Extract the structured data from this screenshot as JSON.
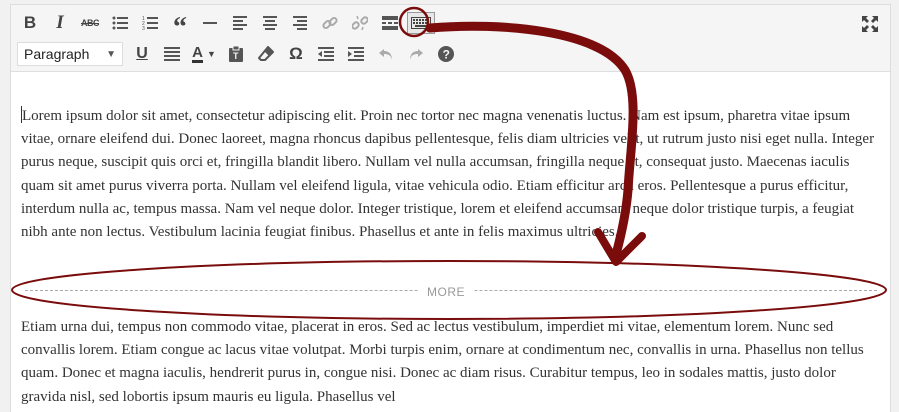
{
  "toolbar": {
    "row1": [
      {
        "name": "bold-button",
        "glyph": "B"
      },
      {
        "name": "italic-button",
        "glyph": "I"
      },
      {
        "name": "strikethrough-button",
        "glyph": "ABC"
      },
      {
        "name": "bulleted-list-button",
        "glyph": "bullets"
      },
      {
        "name": "numbered-list-button",
        "glyph": "numbers"
      },
      {
        "name": "blockquote-button",
        "glyph": "quote"
      },
      {
        "name": "horizontal-line-button",
        "glyph": "hr"
      },
      {
        "name": "align-left-button",
        "glyph": "align-left"
      },
      {
        "name": "align-center-button",
        "glyph": "align-center"
      },
      {
        "name": "align-right-button",
        "glyph": "align-right"
      },
      {
        "name": "insert-link-button",
        "glyph": "link"
      },
      {
        "name": "remove-link-button",
        "glyph": "unlink"
      },
      {
        "name": "insert-more-tag-button",
        "glyph": "more"
      },
      {
        "name": "toolbar-toggle-button",
        "glyph": "keyboard"
      }
    ],
    "format_select": {
      "value": "Paragraph"
    },
    "row2": [
      {
        "name": "underline-button",
        "glyph": "U"
      },
      {
        "name": "justify-button",
        "glyph": "justify"
      },
      {
        "name": "text-color-button",
        "glyph": "A"
      },
      {
        "name": "paste-as-text-button",
        "glyph": "paste"
      },
      {
        "name": "clear-formatting-button",
        "glyph": "eraser"
      },
      {
        "name": "special-character-button",
        "glyph": "Ω"
      },
      {
        "name": "decrease-indent-button",
        "glyph": "outdent"
      },
      {
        "name": "increase-indent-button",
        "glyph": "indent"
      },
      {
        "name": "undo-button",
        "glyph": "undo"
      },
      {
        "name": "redo-button",
        "glyph": "redo"
      },
      {
        "name": "help-button",
        "glyph": "?"
      }
    ]
  },
  "content": {
    "paragraph1": "Lorem ipsum dolor sit amet, consectetur adipiscing elit. Proin nec tortor nec magna venenatis luctus. Nam est ipsum, pharetra vitae ipsum vitae, ornare eleifend dui. Donec laoreet, magna rhoncus dapibus pellentesque, felis diam ultricies velit, ut rutrum justo nisi eget nulla. Integer purus neque, suscipit quis orci et, fringilla blandit libero. Nullam vel nulla accumsan, fringilla neque et, consequat justo. Maecenas iaculis quam sit amet purus viverra porta. Nullam vel eleifend ligula, vitae vehicula odio. Etiam efficitur arcu eros. Pellentesque a purus efficitur, interdum nulla ac, tempus massa. Nam vel neque dolor. Integer tristique, lorem et eleifend accumsan, neque dolor tristique turpis, a feugiat nibh ante non lectus. Vestibulum lacinia feugiat finibus. Phasellus et ante in felis maximus ultricies.",
    "more_label": "MORE",
    "paragraph2": "Etiam urna dui, tempus non commodo vitae, placerat in eros. Sed ac lectus vestibulum, imperdiet mi vitae, elementum lorem. Nunc sed convallis lorem. Etiam congue ac lacus vitae volutpat. Morbi turpis enim, ornare at condimentum nec, convallis in urna. Phasellus non tellus quam. Donec et magna iaculis, hendrerit purus in, congue nisi. Donec ac diam risus. Curabitur tempus, leo in sodales mattis, justo dolor gravida nisl, sed lobortis ipsum mauris eu ligula. Phasellus vel"
  },
  "annotation": {
    "color": "#7a0c0c"
  }
}
